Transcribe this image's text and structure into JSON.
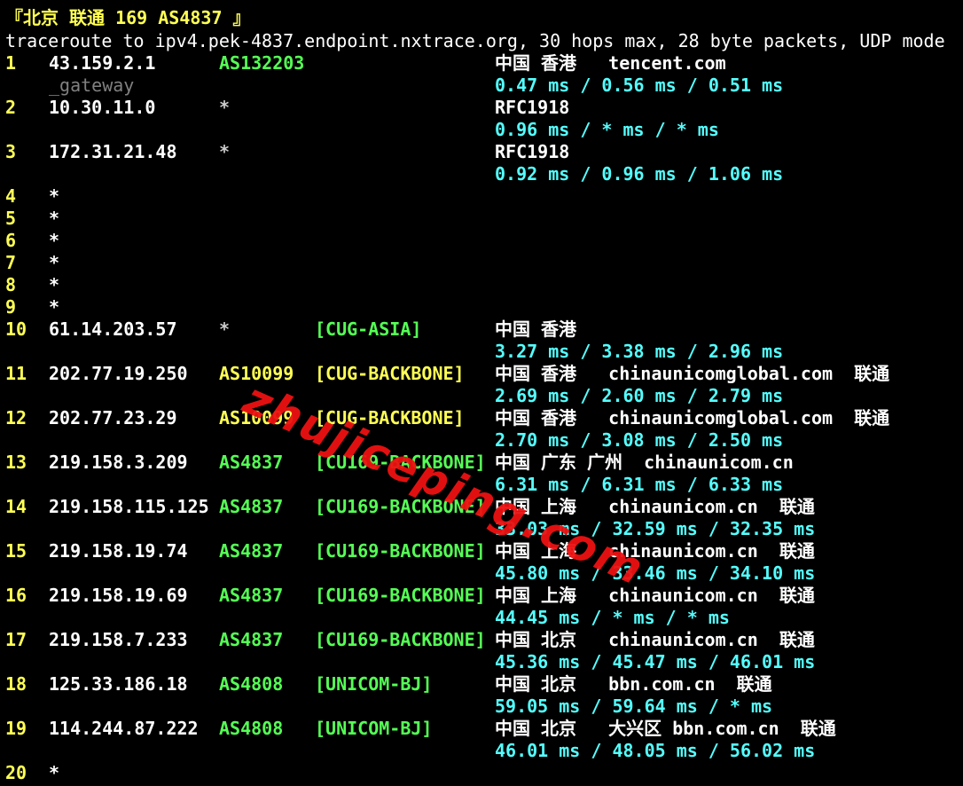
{
  "title": "『北京 联通 169 AS4837 』",
  "command": "traceroute to ipv4.pek-4837.endpoint.nxtrace.org, 30 hops max, 28 byte packets, UDP mode",
  "colors": {
    "background": "#000000",
    "hop_number": "#ffff55",
    "ip": "#ffffff",
    "asn_green": "#55ff55",
    "tag_yellow": "#ffff55",
    "rtt_cyan": "#55ffff",
    "hostname_gray": "#808080",
    "watermark": "#ee1111"
  },
  "watermark": "zhujiceping.com",
  "hops": [
    {
      "hop": "1",
      "ip": "43.159.2.1",
      "asn": "AS132203",
      "asn_color": "#55ff55",
      "tag": "",
      "tag_color": "#55ff55",
      "geo": "中国 香港   tencent.com",
      "hostname": "_gateway",
      "rtt": "0.47 ms / 0.56 ms / 0.51 ms",
      "line": 2
    },
    {
      "hop": "2",
      "ip": "10.30.11.0",
      "asn": "*",
      "asn_color": "#cccccc",
      "tag": "",
      "tag_color": "#55ff55",
      "geo": "RFC1918",
      "hostname": "",
      "rtt": "0.96 ms / * ms / * ms",
      "line": 4
    },
    {
      "hop": "3",
      "ip": "172.31.21.48",
      "asn": "*",
      "asn_color": "#cccccc",
      "tag": "",
      "tag_color": "#55ff55",
      "geo": "RFC1918",
      "hostname": "",
      "rtt": "0.92 ms / 0.96 ms / 1.06 ms",
      "line": 6
    },
    {
      "hop": "4",
      "ip": "*",
      "asn": "",
      "asn_color": "#55ff55",
      "tag": "",
      "tag_color": "#55ff55",
      "geo": "",
      "hostname": "",
      "rtt": "",
      "line": 8
    },
    {
      "hop": "5",
      "ip": "*",
      "asn": "",
      "asn_color": "#55ff55",
      "tag": "",
      "tag_color": "#55ff55",
      "geo": "",
      "hostname": "",
      "rtt": "",
      "line": 9
    },
    {
      "hop": "6",
      "ip": "*",
      "asn": "",
      "asn_color": "#55ff55",
      "tag": "",
      "tag_color": "#55ff55",
      "geo": "",
      "hostname": "",
      "rtt": "",
      "line": 10
    },
    {
      "hop": "7",
      "ip": "*",
      "asn": "",
      "asn_color": "#55ff55",
      "tag": "",
      "tag_color": "#55ff55",
      "geo": "",
      "hostname": "",
      "rtt": "",
      "line": 11
    },
    {
      "hop": "8",
      "ip": "*",
      "asn": "",
      "asn_color": "#55ff55",
      "tag": "",
      "tag_color": "#55ff55",
      "geo": "",
      "hostname": "",
      "rtt": "",
      "line": 12
    },
    {
      "hop": "9",
      "ip": "*",
      "asn": "",
      "asn_color": "#55ff55",
      "tag": "",
      "tag_color": "#55ff55",
      "geo": "",
      "hostname": "",
      "rtt": "",
      "line": 13
    },
    {
      "hop": "10",
      "ip": "61.14.203.57",
      "asn": "*",
      "asn_color": "#cccccc",
      "tag": "[CUG-ASIA]",
      "tag_color": "#55ff55",
      "geo": "中国 香港",
      "hostname": "",
      "rtt": "3.27 ms / 3.38 ms / 2.96 ms",
      "line": 14
    },
    {
      "hop": "11",
      "ip": "202.77.19.250",
      "asn": "AS10099",
      "asn_color": "#ffff55",
      "tag": "[CUG-BACKBONE]",
      "tag_color": "#ffff55",
      "geo": "中国 香港   chinaunicomglobal.com  联通",
      "hostname": "",
      "rtt": "2.69 ms / 2.60 ms / 2.79 ms",
      "line": 16
    },
    {
      "hop": "12",
      "ip": "202.77.23.29",
      "asn": "AS10099",
      "asn_color": "#ffff55",
      "tag": "[CUG-BACKBONE]",
      "tag_color": "#ffff55",
      "geo": "中国 香港   chinaunicomglobal.com  联通",
      "hostname": "",
      "rtt": "2.70 ms / 3.08 ms / 2.50 ms",
      "line": 18
    },
    {
      "hop": "13",
      "ip": "219.158.3.209",
      "asn": "AS4837",
      "asn_color": "#55ff55",
      "tag": "[CU169-BACKBONE]",
      "tag_color": "#55ff55",
      "geo": "中国 广东 广州  chinaunicom.cn",
      "hostname": "",
      "rtt": "6.31 ms / 6.31 ms / 6.33 ms",
      "line": 20
    },
    {
      "hop": "14",
      "ip": "219.158.115.125",
      "asn": "AS4837",
      "asn_color": "#55ff55",
      "tag": "[CU169-BACKBONE]",
      "tag_color": "#55ff55",
      "geo": "中国 上海   chinaunicom.cn  联通",
      "hostname": "",
      "rtt": "33.03 ms / 32.59 ms / 32.35 ms",
      "line": 22
    },
    {
      "hop": "15",
      "ip": "219.158.19.74",
      "asn": "AS4837",
      "asn_color": "#55ff55",
      "tag": "[CU169-BACKBONE]",
      "tag_color": "#55ff55",
      "geo": "中国 上海   chinaunicom.cn  联通",
      "hostname": "",
      "rtt": "45.80 ms / 33.46 ms / 34.10 ms",
      "line": 24
    },
    {
      "hop": "16",
      "ip": "219.158.19.69",
      "asn": "AS4837",
      "asn_color": "#55ff55",
      "tag": "[CU169-BACKBONE]",
      "tag_color": "#55ff55",
      "geo": "中国 上海   chinaunicom.cn  联通",
      "hostname": "",
      "rtt": "44.45 ms / * ms / * ms",
      "line": 26
    },
    {
      "hop": "17",
      "ip": "219.158.7.233",
      "asn": "AS4837",
      "asn_color": "#55ff55",
      "tag": "[CU169-BACKBONE]",
      "tag_color": "#55ff55",
      "geo": "中国 北京   chinaunicom.cn  联通",
      "hostname": "",
      "rtt": "45.36 ms / 45.47 ms / 46.01 ms",
      "line": 28
    },
    {
      "hop": "18",
      "ip": "125.33.186.18",
      "asn": "AS4808",
      "asn_color": "#55ff55",
      "tag": "[UNICOM-BJ]",
      "tag_color": "#55ff55",
      "geo": "中国 北京   bbn.com.cn  联通",
      "hostname": "",
      "rtt": "59.05 ms / 59.64 ms / * ms",
      "line": 30
    },
    {
      "hop": "19",
      "ip": "114.244.87.222",
      "asn": "AS4808",
      "asn_color": "#55ff55",
      "tag": "[UNICOM-BJ]",
      "tag_color": "#55ff55",
      "geo": "中国 北京   大兴区 bbn.com.cn  联通",
      "hostname": "",
      "rtt": "46.01 ms / 48.05 ms / 56.02 ms",
      "line": 32
    },
    {
      "hop": "20",
      "ip": "*",
      "asn": "",
      "asn_color": "#55ff55",
      "tag": "",
      "tag_color": "#55ff55",
      "geo": "",
      "hostname": "",
      "rtt": "",
      "line": 34
    }
  ]
}
